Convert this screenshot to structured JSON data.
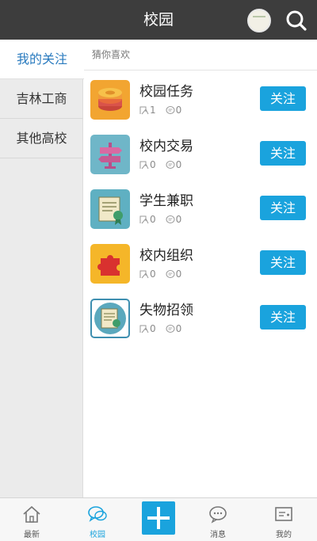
{
  "header": {
    "title": "校园"
  },
  "sidebar": {
    "items": [
      {
        "label": "我的关注"
      },
      {
        "label": "吉林工商"
      },
      {
        "label": "其他高校"
      }
    ]
  },
  "main": {
    "section_label": "猜你喜欢",
    "follow_label": "关注",
    "items": [
      {
        "name": "校园任务",
        "members": "1",
        "posts": "0",
        "icon": "coin-stack-icon",
        "color": "#f2a531"
      },
      {
        "name": "校内交易",
        "members": "0",
        "posts": "0",
        "icon": "signpost-icon",
        "color": "#6fb6c8"
      },
      {
        "name": "学生兼职",
        "members": "0",
        "posts": "0",
        "icon": "certificate-icon",
        "color": "#5fb0c2"
      },
      {
        "name": "校内组织",
        "members": "0",
        "posts": "0",
        "icon": "puzzle-icon",
        "color": "#f5b629"
      },
      {
        "name": "失物招领",
        "members": "0",
        "posts": "0",
        "icon": "certificate-badge-icon",
        "color": "#5aa8bd"
      }
    ]
  },
  "bottom_nav": {
    "items": [
      {
        "label": "最新",
        "icon": "home-icon"
      },
      {
        "label": "校园",
        "icon": "chat-bubbles-icon"
      },
      {
        "label": "",
        "icon": "plus-icon"
      },
      {
        "label": "消息",
        "icon": "message-icon"
      },
      {
        "label": "我的",
        "icon": "profile-card-icon"
      }
    ]
  },
  "colors": {
    "accent": "#1aa3dd",
    "header": "#3d3d3d",
    "sidebar_active_text": "#2a7bbf"
  }
}
